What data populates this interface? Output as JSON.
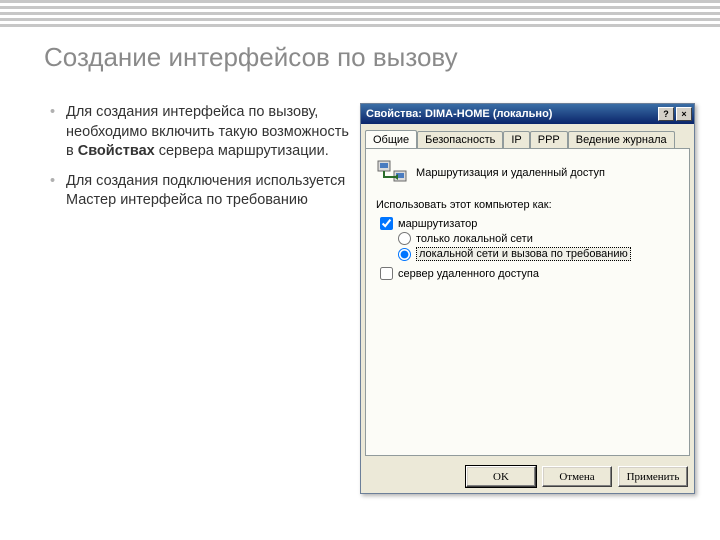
{
  "slide": {
    "title": "Создание интерфейсов по вызову",
    "bullets": [
      {
        "pre": "Для создания интерфейса по вызову, необходимо включить такую возможность в ",
        "bold": "Свойствах",
        "post": " сервера маршрутизации."
      },
      {
        "pre": "Для создания подключения используется Мастер интерфейса по требованию",
        "bold": "",
        "post": ""
      }
    ]
  },
  "dialog": {
    "title": "Свойства: DIMA-HOME (локально)",
    "help_btn": "?",
    "close_btn": "×",
    "tabs": [
      "Общие",
      "Безопасность",
      "IP",
      "PPP",
      "Ведение журнала"
    ],
    "panel_heading": "Маршрутизация и удаленный доступ",
    "section_label": "Использовать этот компьютер как:",
    "cb_router": "маршрутизатор",
    "rb_lan_only": "только локальной сети",
    "rb_lan_and_demand": "локальной сети и вызова по требованию",
    "cb_ras": "сервер удаленного доступа",
    "buttons": {
      "ok": "OK",
      "cancel": "Отмена",
      "apply": "Применить"
    }
  }
}
